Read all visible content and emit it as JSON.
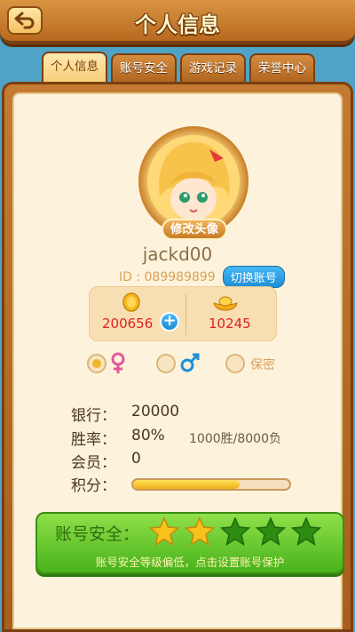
{
  "header": {
    "title": "个人信息"
  },
  "tabs": [
    {
      "label": "个人信息",
      "active": true
    },
    {
      "label": "账号安全",
      "active": false
    },
    {
      "label": "游戏记录",
      "active": false
    },
    {
      "label": "荣誉中心",
      "active": false
    }
  ],
  "profile": {
    "edit_avatar_label": "修改头像",
    "username": "jackd00",
    "id_text": "ID : 089989899",
    "switch_account_label": "切换账号"
  },
  "currency": {
    "coins": "200656",
    "ingots": "10245"
  },
  "gender": {
    "selected": "female",
    "secret_label": "保密"
  },
  "stats": {
    "bank_label": "银行：",
    "bank_value": "20000",
    "winrate_label": "胜率：",
    "winrate_value": "80%",
    "record": "1000胜/8000负",
    "member_label": "会员：",
    "member_value": "0",
    "score_label": "积分：",
    "score_fraction": 0.68
  },
  "security": {
    "title": "账号安全：",
    "stars_filled": 2,
    "stars_total": 5,
    "tip": "账号安全等级偏低，点击设置账号保护",
    "star_filled_color": "#f7c21c",
    "star_empty_color": "#2d8c12"
  }
}
